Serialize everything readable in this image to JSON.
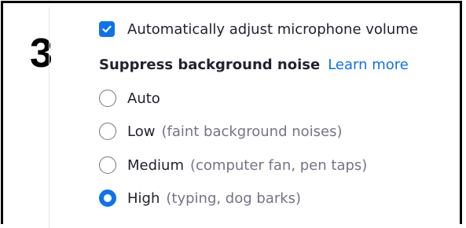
{
  "step_number": "3",
  "auto_adjust": {
    "label": "Automatically adjust microphone volume",
    "checked": true
  },
  "suppress": {
    "heading": "Suppress background noise",
    "learn_more": "Learn more",
    "options": [
      {
        "label": "Auto",
        "hint": "",
        "selected": false
      },
      {
        "label": "Low",
        "hint": "(faint background noises)",
        "selected": false
      },
      {
        "label": "Medium",
        "hint": "(computer fan, pen taps)",
        "selected": false
      },
      {
        "label": "High",
        "hint": "(typing, dog barks)",
        "selected": true
      }
    ]
  },
  "colors": {
    "accent": "#0e72ed",
    "text": "#222230",
    "hint": "#747487",
    "step_number": "#000000"
  },
  "icons": {
    "checkbox": "checkmark-icon"
  }
}
